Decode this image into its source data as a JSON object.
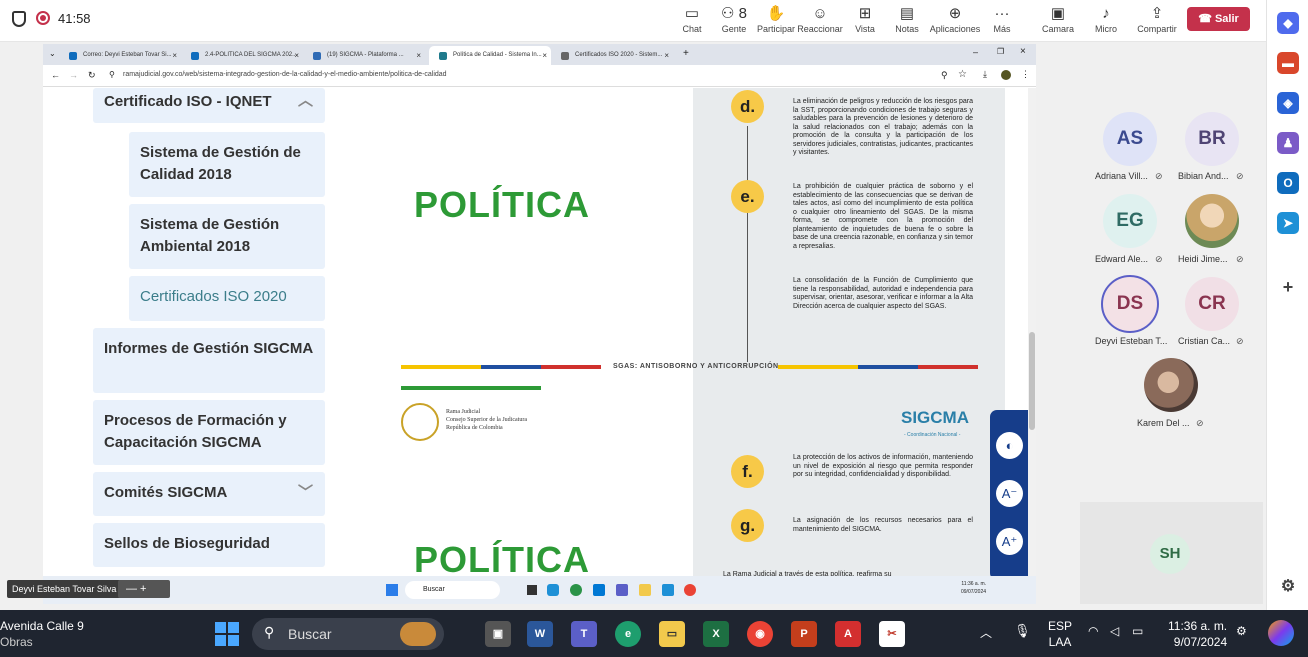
{
  "teams": {
    "timer": "41:58",
    "buttons": [
      {
        "label": "Chat",
        "icon": "chat-icon",
        "glyph": "▭"
      },
      {
        "label": "Gente",
        "icon": "people-icon",
        "glyph": "⚇ 8"
      },
      {
        "label": "Participar",
        "icon": "raise-hand-icon",
        "glyph": "✋"
      },
      {
        "label": "Reaccionar",
        "icon": "react-icon",
        "glyph": "☺"
      },
      {
        "label": "Vista",
        "icon": "view-icon",
        "glyph": "⊞"
      },
      {
        "label": "Notas",
        "icon": "notes-icon",
        "glyph": "▤"
      },
      {
        "label": "Aplicaciones",
        "icon": "apps-icon",
        "glyph": "⊕"
      },
      {
        "label": "Más",
        "icon": "more-icon",
        "glyph": "···"
      },
      {
        "label": "Camara",
        "icon": "camera-off-icon",
        "glyph": "▣"
      },
      {
        "label": "Micro",
        "icon": "mic-off-icon",
        "glyph": "♪"
      },
      {
        "label": "Compartir",
        "icon": "share-icon",
        "glyph": "⇪"
      }
    ],
    "leave_label": "Salir",
    "accent": "#c4314b"
  },
  "browser": {
    "tabs": [
      {
        "label": "Correo: Deyvi Esteban Tovar Si...",
        "color": "#0f6cbd"
      },
      {
        "label": "2.4-POLITICA DEL SIGCMA 202...",
        "color": "#0f6cbd"
      },
      {
        "label": "(19) SIGCMA - Plataforma ...",
        "color": "#2f6bb5"
      },
      {
        "label": "Política de Calidad - Sistema In...",
        "color": "#1f7a8c"
      },
      {
        "label": "Certificados ISO 2020 - Sistem...",
        "color": "#666666"
      }
    ],
    "url": "ramajudicial.gov.co/web/sistema-integrado-gestion-de-la-calidad-y-el-medio-ambiente/politica-de-calidad"
  },
  "sidenav": {
    "header": "Certificado ISO - IQNET",
    "subitems": [
      "Sistema de Gestión de Calidad 2018",
      "Sistema de Gestión Ambiental 2018",
      "Certificados ISO 2020"
    ],
    "items": [
      "Informes de Gestión SIGCMA",
      "Procesos de Formación y Capacitación SIGCMA",
      "Comités SIGCMA",
      "Sellos de Bioseguridad"
    ]
  },
  "policy": {
    "title": "POLÍTICA",
    "title2": "POLÍTICA",
    "band_text": "SGAS: ANTISOBORNO Y ANTICORRUPCIÓN",
    "logo_lines": [
      "Rama Judicial",
      "Consejo Superior de la Judicatura",
      "República de Colombia"
    ],
    "sigcma": "SIGCMA",
    "sigcma_sub": "- Coordinación Nacional -",
    "items": [
      {
        "letter": "d.",
        "text": "La eliminación de peligros y reducción de los riesgos para la SST, proporcionando condiciones de trabajo seguras y saludables para la prevención de lesiones y deterioro de la salud relacionados con el trabajo; además con la promoción de la consulta y la participación de los servidores judiciales, contratistas, judicantes, practicantes y visitantes."
      },
      {
        "letter": "e.",
        "text": "La prohibición de cualquier práctica de soborno y el establecimiento de las consecuencias que se derivan de tales actos, así como del incumplimiento de esta política o cualquier otro lineamiento del SGAS. De la misma forma, se compromete con la promoción del planteamiento de inquietudes de buena fe o sobre la base de una creencia razonable, en confianza y sin temor a represalias."
      },
      {
        "letter": "",
        "text": "La consolidación de la Función de Cumplimiento que tiene la responsabilidad, autoridad e independencia para supervisar, orientar, asesorar, verificar e informar a la Alta Dirección acerca de cualquier aspecto del SGAS."
      },
      {
        "letter": "f.",
        "text": "La protección de los activos de información, manteniendo un nivel de exposición al riesgo que permita responder por su integridad, confidencialidad y disponibilidad."
      },
      {
        "letter": "g.",
        "text": "La asignación de los recursos necesarios para el mantenimiento del SIGCMA."
      },
      {
        "letter": "",
        "text": "La Rama Judicial a través de esta política, reafirma su"
      }
    ]
  },
  "inner_taskbar": {
    "search": "Buscar",
    "time": "11:36 a. m.",
    "date": "09/07/2024"
  },
  "participants": [
    {
      "initials": "AS",
      "name": "Adriana Vill...",
      "bg": "#dfe3f7",
      "fg": "#3b4a8f"
    },
    {
      "initials": "BR",
      "name": "Bibian And...",
      "bg": "#e8e4f3",
      "fg": "#4f4474"
    },
    {
      "initials": "EG",
      "name": "Edward Ale...",
      "bg": "#dff1ef",
      "fg": "#2f6b64"
    },
    {
      "initials": "",
      "name": "Heidi Jime...",
      "bg": "#c9b48a",
      "fg": "#ffffff"
    },
    {
      "initials": "DS",
      "name": "Deyvi Esteban T...",
      "bg": "#f3e1e6",
      "fg": "#8a3450"
    },
    {
      "initials": "CR",
      "name": "Cristian Ca...",
      "bg": "#f1dfe6",
      "fg": "#8a3450"
    },
    {
      "initials": "",
      "name": "Karem Del ...",
      "bg": "#8a6a5a",
      "fg": "#ffffff"
    }
  ],
  "sh_tile": {
    "initials": "SH"
  },
  "presenter": "Deyvi Esteban Tovar Silva",
  "presenter_ctl": "—   +",
  "taskbar": {
    "weather_line1": "Avenida Calle 9",
    "weather_line2": "Obras",
    "search": "Buscar",
    "lang1": "ESP",
    "lang2": "LAA",
    "time": "11:36 a. m.",
    "date": "9/07/2024"
  }
}
